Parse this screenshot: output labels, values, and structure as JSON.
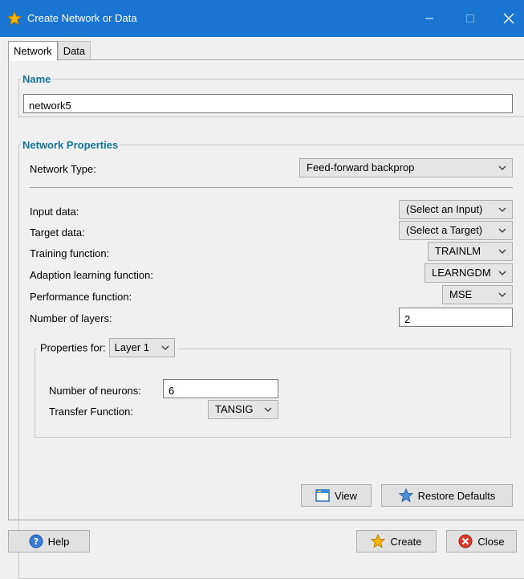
{
  "window": {
    "title": "Create Network or Data"
  },
  "tabs": [
    {
      "label": "Network"
    },
    {
      "label": "Data"
    }
  ],
  "name_group": {
    "legend": "Name",
    "value": "network5"
  },
  "props_group": {
    "legend": "Network Properties",
    "network_type_label": "Network Type:",
    "network_type_value": "Feed-forward backprop",
    "input_data_label": "Input data:",
    "input_data_value": "(Select an Input)",
    "target_data_label": "Target data:",
    "target_data_value": "(Select a Target)",
    "training_fn_label": "Training function:",
    "training_fn_value": "TRAINLM",
    "adaption_fn_label": "Adaption learning function:",
    "adaption_fn_value": "LEARNGDM",
    "performance_fn_label": "Performance function:",
    "performance_fn_value": "MSE",
    "num_layers_label": "Number of layers:",
    "num_layers_value": "2"
  },
  "layer_group": {
    "legend_label": "Properties for:",
    "layer_value": "Layer 1",
    "neurons_label": "Number of neurons:",
    "neurons_value": "6",
    "transfer_label": "Transfer Function:",
    "transfer_value": "TANSIG"
  },
  "buttons": {
    "view": "View",
    "restore": "Restore Defaults",
    "help": "Help",
    "create": "Create",
    "close": "Close"
  },
  "colors": {
    "titlebar": "#1a75d2",
    "legend": "#14769a"
  }
}
